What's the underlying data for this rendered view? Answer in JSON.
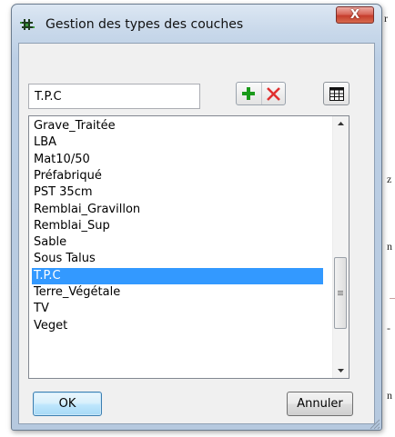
{
  "background": {
    "fragments": [
      "r",
      "z",
      "n",
      "-",
      "n"
    ]
  },
  "dialog": {
    "title": "Gestion des types des couches",
    "icon": "layer-grid-icon",
    "close_label": "X"
  },
  "name_input": {
    "value": "T.P.C"
  },
  "toolbar": {
    "add_icon": "plus-icon",
    "delete_icon": "red-x-icon",
    "table_icon": "table-grid-icon"
  },
  "list": {
    "items": [
      "Grave_Traitée",
      "LBA",
      "Mat10/50",
      "Préfabriqué",
      "PST 35cm",
      "Remblai_Gravillon",
      "Remblai_Sup",
      "Sable",
      "Sous Talus",
      "T.P.C",
      "Terre_Végétale",
      "TV",
      "Veget"
    ],
    "selected": "T.P.C",
    "scroll_position": 0.79,
    "visible_fraction": 0.31
  },
  "buttons": {
    "ok_label": "OK",
    "cancel_label": "Annuler"
  },
  "colors": {
    "selection": "#3399ff",
    "close_button": "#c63d2d",
    "add_green": "#1a9a1a",
    "delete_red": "#e03030"
  }
}
